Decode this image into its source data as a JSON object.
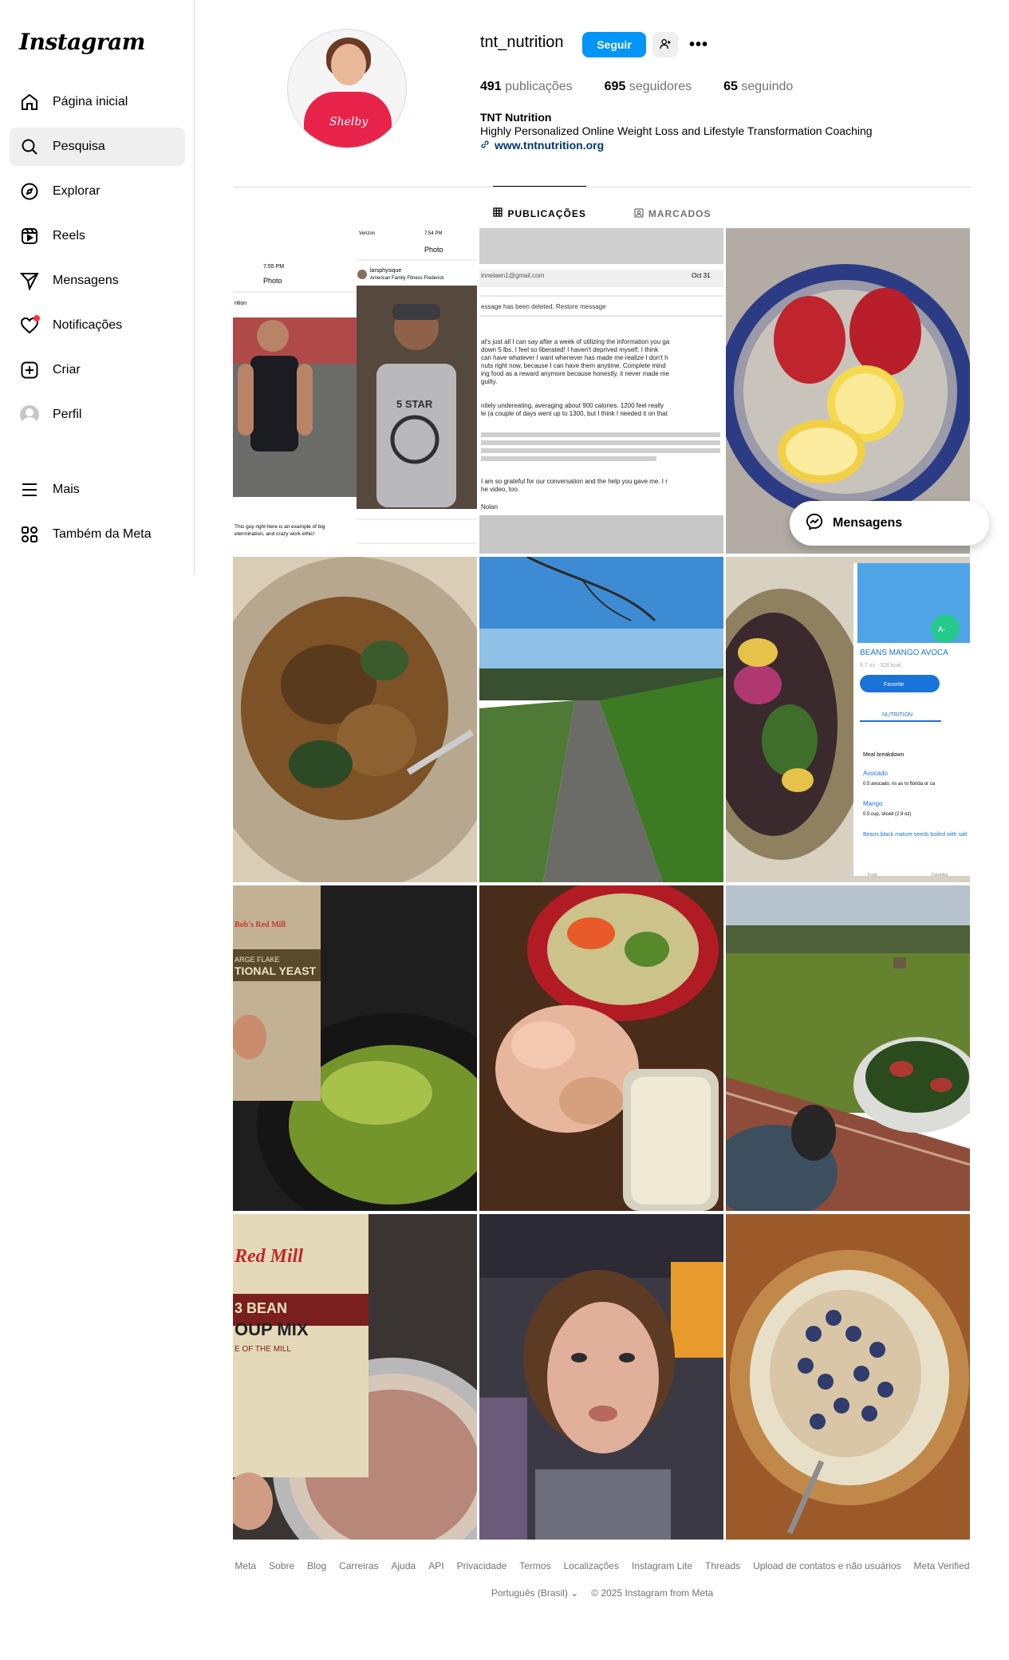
{
  "app": {
    "logo": "Instagram"
  },
  "sidebar": {
    "items": [
      {
        "label": "Página inicial",
        "icon": "home-icon"
      },
      {
        "label": "Pesquisa",
        "icon": "search-icon"
      },
      {
        "label": "Explorar",
        "icon": "explore-icon"
      },
      {
        "label": "Reels",
        "icon": "reels-icon"
      },
      {
        "label": "Mensagens",
        "icon": "messages-icon"
      },
      {
        "label": "Notificações",
        "icon": "heart-icon"
      },
      {
        "label": "Criar",
        "icon": "plus-square-icon"
      },
      {
        "label": "Perfil",
        "icon": "avatar"
      }
    ],
    "bottom": [
      {
        "label": "Mais",
        "icon": "menu-icon"
      },
      {
        "label": "Também da Meta",
        "icon": "meta-apps-icon"
      }
    ]
  },
  "profile": {
    "username": "tnt_nutrition",
    "follow_label": "Seguir",
    "stats": {
      "posts_count": "491",
      "posts_label": "publicações",
      "followers_count": "695",
      "followers_label": "seguidores",
      "following_count": "65",
      "following_label": "seguindo"
    },
    "bio_name": "TNT Nutrition",
    "bio_text": "Highly Personalized Online Weight Loss and Lifestyle Transformation Coaching",
    "bio_link": "www.tntnutrition.org",
    "pic_script": "Shelby"
  },
  "tabs": [
    {
      "label": "PUBLICAÇÕES",
      "icon": "grid-icon"
    },
    {
      "label": "MARCADOS",
      "icon": "tagged-icon"
    }
  ],
  "posts": {
    "p1": {
      "time_left": "7:55 PM",
      "title_left": "Photo",
      "label_left": "rition",
      "caption": "This guy right here is an example of big",
      "caption2": "etermination, and crazy work ethic!",
      "carrier": "Verizon",
      "time_right": "7:54 PM",
      "title_right": "Photo",
      "user": "larsphysique",
      "user_sub": "American Family Fitness Frederick",
      "shirt": "5 STAR"
    },
    "p2": {
      "email": "innelaen1@gmail.com",
      "date": "Oct 31",
      "deleted": "essage has been deleted. Restore message",
      "l1": "at's just all I can say after a week of utilizing the information you ga",
      "l2": "down 5 lbs.  I feel so liberated!  I haven't deprived myself.  I think",
      "l3": "can have whatever I want whenever has made me realize I don't h",
      "l4": "nuts right now, because I can have them anytime.  Complete mind",
      "l5": "ing food as a reward anymore because honestly, it never made me",
      "l6": "guilty.",
      "l7": "nitely undereating, averaging about 900 calories.  1200 feel really",
      "l8": "le (a couple of days went up to 1300, but I think I needed it on that",
      "l9": "I am so grateful for our conversation and the help you gave me.  I r",
      "l10": "he video, too.",
      "l11": "Nolan"
    },
    "p6": {
      "title": "BEANS MANGO AVOCA",
      "sub": "9.7 oz · 326 kcal",
      "fav": "Favorite",
      "nutrition": "NUTRITION",
      "meal": "Meal breakdown",
      "i1": "Avocado",
      "i1d": "0.5 avocado, ns as to florida or ca",
      "i2": "Mango",
      "i2d": "0.5 cup, sliced (2.9 oz)",
      "i3": "Beans black mature seeds boiled with salt",
      "food": "Food",
      "fav2": "Favorites",
      "badge": "A-"
    },
    "p7": {
      "brand": "Bob's Red Mill",
      "l1": "ARGE FLAKE",
      "l2": "TIONAL YEAST"
    },
    "p10": {
      "brand": "Red Mill",
      "l1": "3 BEAN",
      "l2": "OUP MIX",
      "l3": "E OF THE MILL"
    }
  },
  "messages_pill": "Mensagens",
  "footer": {
    "links": [
      "Meta",
      "Sobre",
      "Blog",
      "Carreiras",
      "Ajuda",
      "API",
      "Privacidade",
      "Termos",
      "Localizações",
      "Instagram Lite",
      "Threads",
      "Upload de contatos e não usuários",
      "Meta Verified"
    ],
    "language": "Português (Brasil)",
    "copyright": "© 2025 Instagram from Meta"
  },
  "colors": {
    "primary": "#0095f6",
    "link": "#00376b",
    "notif": "#ff3040",
    "muted": "#737373"
  }
}
